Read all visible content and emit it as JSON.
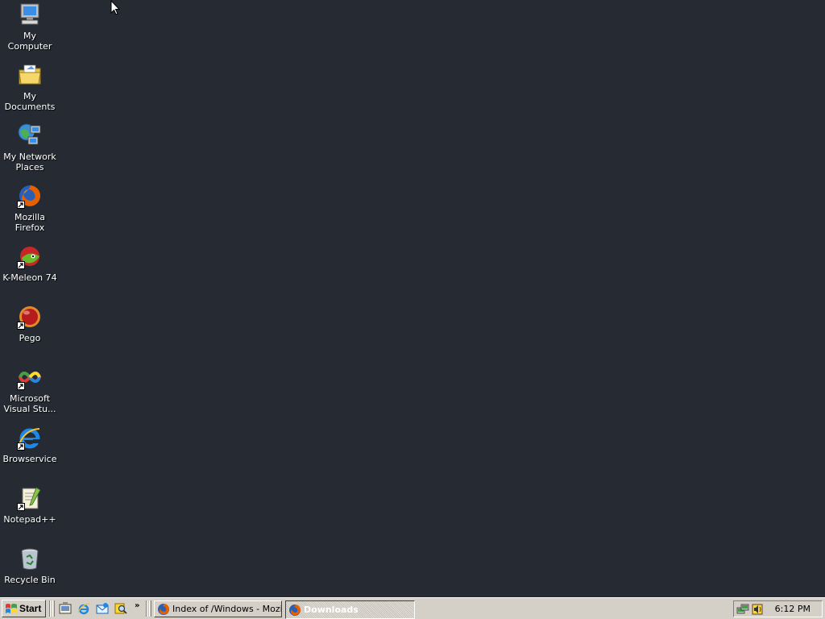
{
  "desktop": {
    "background_color": "#252a33",
    "icons": [
      {
        "label": "My Computer",
        "icon": "computer-icon",
        "shortcut": false
      },
      {
        "label": "My Documents",
        "icon": "documents-folder-icon",
        "shortcut": false
      },
      {
        "label": "My Network\nPlaces",
        "icon": "network-places-icon",
        "shortcut": false
      },
      {
        "label": "Mozilla Firefox",
        "icon": "firefox-icon",
        "shortcut": true
      },
      {
        "label": "K-Meleon 74",
        "icon": "k-meleon-icon",
        "shortcut": true
      },
      {
        "label": "Pego",
        "icon": "pego-icon",
        "shortcut": true
      },
      {
        "label": "Microsoft\nVisual Stu...",
        "icon": "visual-studio-icon",
        "shortcut": true
      },
      {
        "label": "Browservice",
        "icon": "internet-explorer-icon",
        "shortcut": true
      },
      {
        "label": "Notepad++",
        "icon": "notepad-plus-plus-icon",
        "shortcut": true
      },
      {
        "label": "Recycle Bin",
        "icon": "recycle-bin-icon",
        "shortcut": false
      }
    ]
  },
  "taskbar": {
    "start_label": "Start",
    "quick_launch": [
      "show-desktop-icon",
      "internet-explorer-icon",
      "outlook-express-icon",
      "search-icon"
    ],
    "overflow_label": "»",
    "tasks": [
      {
        "label": "Index of /Windows - Mozil...",
        "icon": "firefox-icon",
        "active": false
      },
      {
        "label": "Downloads",
        "icon": "firefox-icon",
        "active": true
      }
    ],
    "tray_icons": [
      "network-icon",
      "volume-icon"
    ],
    "clock": "6:12 PM"
  }
}
